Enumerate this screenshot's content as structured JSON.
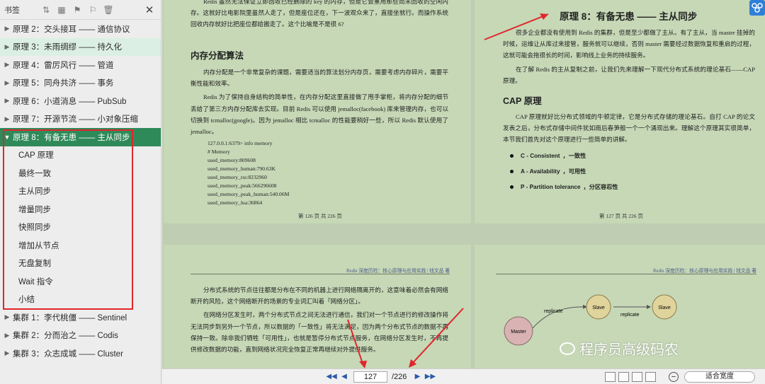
{
  "sidebar": {
    "title": "书签",
    "items": [
      {
        "label": "原理 2：交头接耳 —— 通信协议"
      },
      {
        "label": "原理 3：未雨绸缪 —— 持久化"
      },
      {
        "label": "原理 4：雷厉风行 —— 管道"
      },
      {
        "label": "原理 5：同舟共济 —— 事务"
      },
      {
        "label": "原理 6：小道消息 —— PubSub"
      },
      {
        "label": "原理 7：开源节流 —— 小对象压缩"
      },
      {
        "label": "原理 8：有备无患 —— 主从同步"
      }
    ],
    "subitems": [
      "CAP 原理",
      "最终一致",
      "主从同步",
      "增量同步",
      "快照同步",
      "增加从节点",
      "无盘复制",
      "Wait 指令",
      "小结"
    ],
    "clusters": [
      {
        "label": "集群 1：李代桃僵 —— Sentinel"
      },
      {
        "label": "集群 2：分而治之 —— Codis"
      },
      {
        "label": "集群 3：众志成城 —— Cluster"
      }
    ]
  },
  "page_tl": {
    "p0": "Redis 虽然无法保证立即回收已经删除的 key 的内存，但是它会重用那些尚未回收的空闲内存。这就好比电影院里虽然人走了，但是座位还在，下一波观众来了，直接坐就行。而操作系统回收内存就好比把座位都给搬走了。这个比喻是不是很 6?",
    "heading": "内存分配算法",
    "p1": "内存分配是一个非常复杂的课题，需要适当的算法划分内存页，需要考虑内存碎片，需要平衡性能和效率。",
    "p2": "Redis 为了保持自身结构的简单性，在内存分配这里直接做了甩手掌柜，将内存分配的细节丢给了第三方内存分配库去实现。目前 Redis 可以使用 jemalloc(facebook) 库来管理内存，也可以切换到 tcmalloc(google)。因为 jemalloc 相比 tcmalloc 的性能要稍好一些，所以 Redis 默认使用了 jemalloc。",
    "code": [
      "127.0.0.1:6379> info memory",
      "# Memory",
      "used_memory:809608",
      "used_memory_human:790.63K",
      "used_memory_rss:8232960",
      "used_memory_peak:566296608",
      "used_memory_peak_human:540.06M",
      "used_memory_lua:36864"
    ],
    "pnum": "第 126 页 共 226 页"
  },
  "page_tr": {
    "title": "原理 8：有备无患 —— 主从同步",
    "p1": "很多企业都没有使用到 Redis 的集群，但是至少都做了主从。有了主从，当 master 挂掉的时候，运维让从库过来接管，服务就可以继续，否则 master 需要经过数据恢复和重启的过程，这就可能会拖很长的时间，影响线上业务的持续服务。",
    "p2": "在了解 Redis 的主从复制之前，让我们先来理解一下现代分布式系统的理论基石——CAP 原理。",
    "heading": "CAP 原理",
    "p3": "CAP 原理就好比分布式领域的牛顿定律，它是分布式存储的理论基石。自打 CAP 的论文发表之后，分布式存储中间件犹如雨后春笋般一个一个涌现出来。理解这个原理其实很简单，本节我们首先对这个原理进行一些简单的讲解。",
    "bullets": [
      {
        "key": "C - Consistent",
        "val": "，一致性"
      },
      {
        "key": "A - Availability",
        "val": "，可用性"
      },
      {
        "key": "P - Partition tolerance",
        "val": "，分区容忍性"
      }
    ],
    "pnum": "第 127 页 共 226 页"
  },
  "page_bl": {
    "header": "Redis 深度历险：核心原理与应用实践 | 钱文品 著",
    "p1": "分布式系统的节点往往都是分布在不同的机器上进行网络隔离开的，这意味着必然会有网络断开的风险，这个网络断开的场景的专业词汇叫着「网络分区」。",
    "p2": "在网络分区发生时，两个分布式节点之间无法进行通信，我们对一个节点进行的修改操作将无法同步到另外一个节点，所以数据的「一致性」将无法满足，因为两个分布式节点的数据不再保持一致。除非我们牺牲「可用性」，也就是暂停分布式节点服务，在网络分区发生时，不再提供修改数据的功能，直到网络状况完全恢复正常再继续对外提供服务。"
  },
  "page_br": {
    "header": "Redis 深度历险：核心原理与应用实践 | 钱文品 著",
    "diagram": {
      "master": "Master",
      "slave1": "Slave",
      "slave2": "Slave",
      "replicate1": "replicate",
      "replicate2": "replicate"
    },
    "watermark": "程序员高级码农"
  },
  "bottombar": {
    "current_page": "127",
    "total_pages": "/226",
    "zoom": "适合宽度"
  },
  "colors": {
    "active": "#2f8a5a",
    "highlight": "#e0262b",
    "page_bg": "#c6d8b6"
  }
}
